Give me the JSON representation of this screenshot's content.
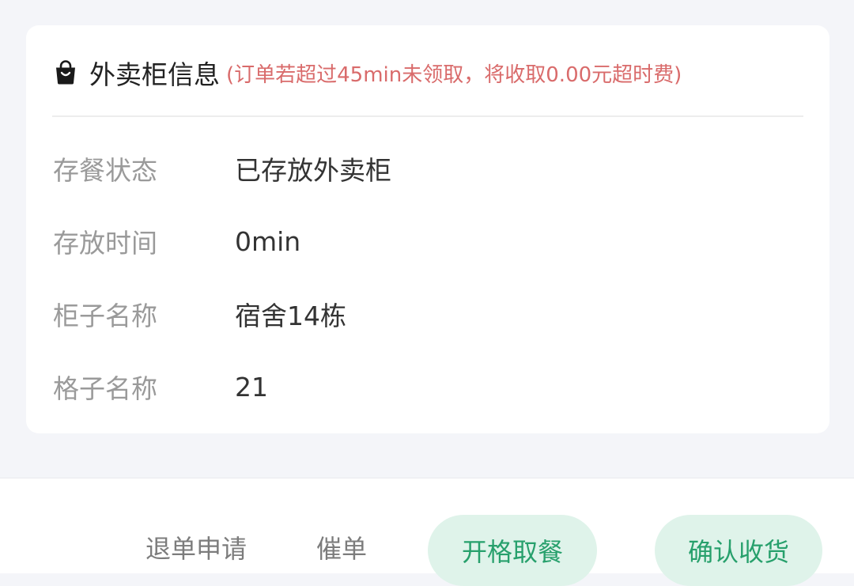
{
  "locker_card": {
    "icon": "shopping-bag-icon",
    "title": "外卖柜信息",
    "note": "(订单若超过45min未领取，将收取0.00元超时费)",
    "rows": [
      {
        "label": "存餐状态",
        "value": "已存放外卖柜"
      },
      {
        "label": "存放时间",
        "value": "0min"
      },
      {
        "label": "柜子名称",
        "value": "宿舍14栋"
      },
      {
        "label": "格子名称",
        "value": "21"
      }
    ]
  },
  "bottom_bar": {
    "refund_label": "退单申请",
    "urge_label": "催单",
    "open_cell_label": "开格取餐",
    "confirm_label": "确认收货"
  },
  "colors": {
    "note_red": "#d96b6b",
    "accent_green": "#27a06c",
    "pill_bg": "#dff3ea"
  }
}
